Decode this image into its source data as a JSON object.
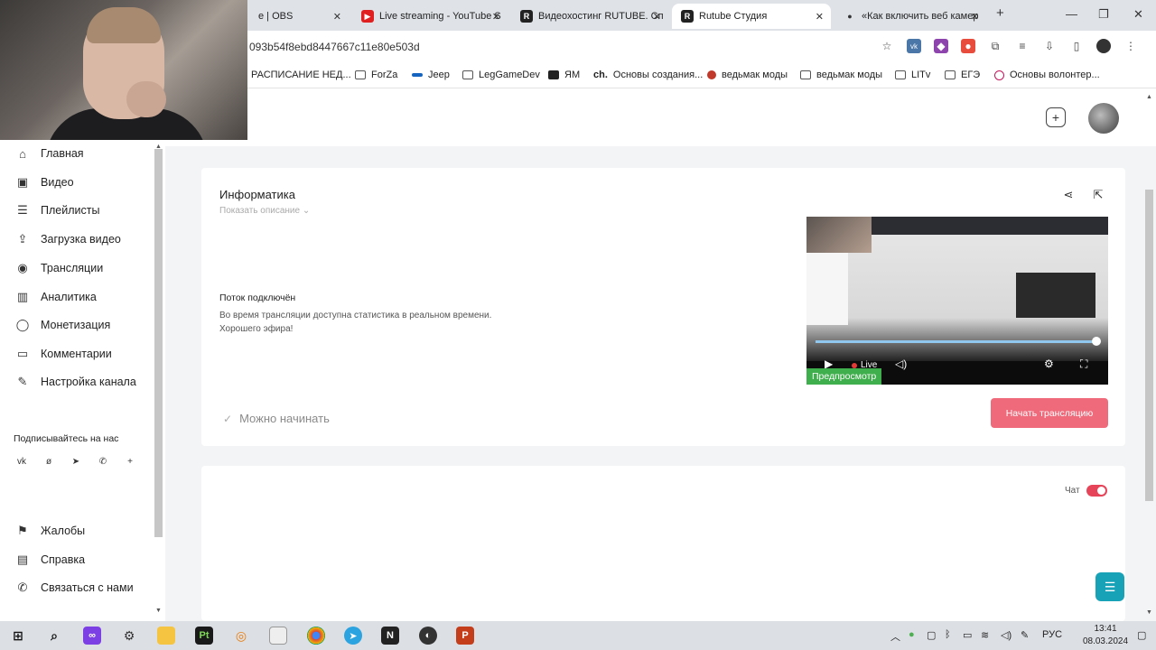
{
  "browser": {
    "tabs": [
      {
        "title": "e | OBS",
        "icon": "obs-icon"
      },
      {
        "title": "Live streaming - YouTube S",
        "icon": "youtube-icon"
      },
      {
        "title": "Видеохостинг RUTUBE. Сп",
        "icon": "rutube-icon"
      },
      {
        "title": "Rutube Студия",
        "icon": "rutube-icon"
      },
      {
        "title": "«Как включить веб камер",
        "icon": "pin-icon"
      }
    ],
    "new_tab": "+",
    "url": "093b54f8ebd8447667c11e80e503d",
    "bookmarks": [
      "РАСПИСАНИЕ НЕД...",
      "ForZa",
      "Jeep",
      "LegGameDev",
      "ЯМ",
      "Основы создания...",
      "ведьмак моды",
      "ведьмак моды",
      "LITv",
      "ЕГЭ",
      "Основы волонтер..."
    ]
  },
  "sidebar": {
    "items": [
      {
        "label": "Главная",
        "icon": "home-icon"
      },
      {
        "label": "Видео",
        "icon": "video-icon"
      },
      {
        "label": "Плейлисты",
        "icon": "playlist-icon"
      },
      {
        "label": "Загрузка видео",
        "icon": "upload-icon"
      },
      {
        "label": "Трансляции",
        "icon": "broadcast-icon"
      },
      {
        "label": "Аналитика",
        "icon": "analytics-icon"
      },
      {
        "label": "Монетизация",
        "icon": "money-icon"
      },
      {
        "label": "Комментарии",
        "icon": "comment-icon"
      },
      {
        "label": "Настройка канала",
        "icon": "edit-icon"
      }
    ],
    "social_label": "Подписывайтесь на нас",
    "socials": [
      "vk-icon",
      "ok-icon",
      "telegram-icon",
      "viber-icon",
      "plus-icon"
    ],
    "bottom_items": [
      {
        "label": "Жалобы",
        "icon": "flag-icon"
      },
      {
        "label": "Справка",
        "icon": "book-icon"
      },
      {
        "label": "Связаться с нами",
        "icon": "phone-icon"
      }
    ]
  },
  "stream": {
    "title": "Информатика",
    "show_description": "Показать описание",
    "status_heading": "Поток подключён",
    "status_line1": "Во время трансляции доступна статистика в реальном времени.",
    "status_line2": "Хорошего эфира!",
    "ready": "Можно начинать",
    "start_button": "Начать трансляцию",
    "preview_badge": "Предпросмотр",
    "live_label": "Live"
  },
  "chat": {
    "label": "Чат",
    "enabled": true
  },
  "taskbar": {
    "lang": "РУС",
    "time": "13:41",
    "date": "08.03.2024"
  },
  "colors": {
    "accent_red": "#ef6b7b",
    "toggle_red": "#e64459",
    "preview_green": "#3fae4c",
    "help_teal": "#17a2b8"
  }
}
